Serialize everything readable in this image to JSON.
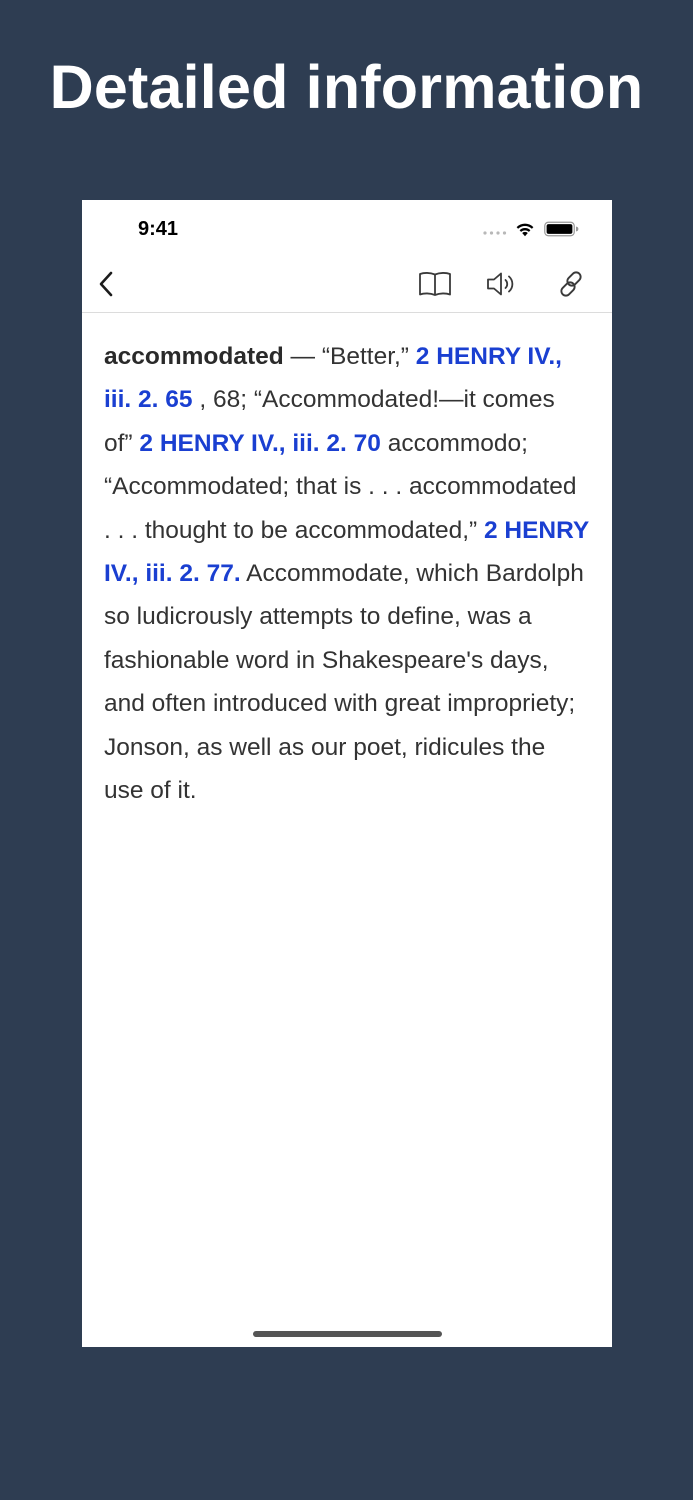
{
  "headline": "Detailed information",
  "status_bar": {
    "time": "9:41"
  },
  "nav": {
    "back_icon": "chevron-left-icon",
    "book_icon": "book-icon",
    "sound_icon": "speaker-icon",
    "link_icon": "link-icon"
  },
  "entry": {
    "headword": "accommodated",
    "text_1": " — “Better,” ",
    "ref_1": "2 HENRY IV., iii. 2. 65",
    "text_2": " , 68; “Accommodated!—it comes of” ",
    "ref_2": "2 HENRY IV., iii. 2. 70",
    "text_3": " accommodo; “Accommodated; that is . . . accommodated . . . thought to be accommodated,” ",
    "ref_3": "2 HENRY IV., iii. 2. 77.",
    "text_4": " Accommodate, which Bardolph so ludicrously attempts to define, was a fashionable word in Shakespeare's days, and often introduced with great impropriety; Jonson, as well as our poet, ridicules the use of it."
  },
  "colors": {
    "background": "#2e3d52",
    "link": "#1a3fd1",
    "text": "#333333"
  }
}
